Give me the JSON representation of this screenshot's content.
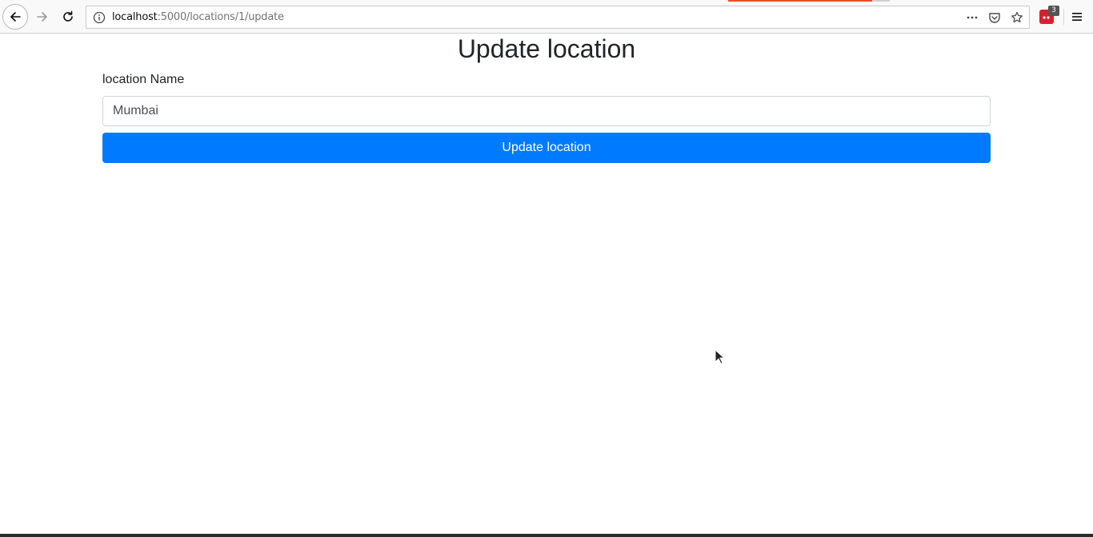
{
  "browser": {
    "url_host": "localhost",
    "url_rest": ":5000/locations/1/update",
    "extension_badge": "3",
    "icons": {
      "back": "back-arrow-icon",
      "forward": "forward-arrow-icon",
      "reload": "reload-icon",
      "info": "info-icon",
      "more": "more-actions-icon",
      "pocket": "pocket-icon",
      "bookmark": "bookmark-star-icon",
      "menu": "hamburger-menu-icon"
    }
  },
  "page": {
    "title": "Update location",
    "form": {
      "label": "location Name",
      "input_value": "Mumbai",
      "submit_label": "Update location"
    }
  },
  "colors": {
    "primary": "#007bff",
    "text": "#212529"
  }
}
